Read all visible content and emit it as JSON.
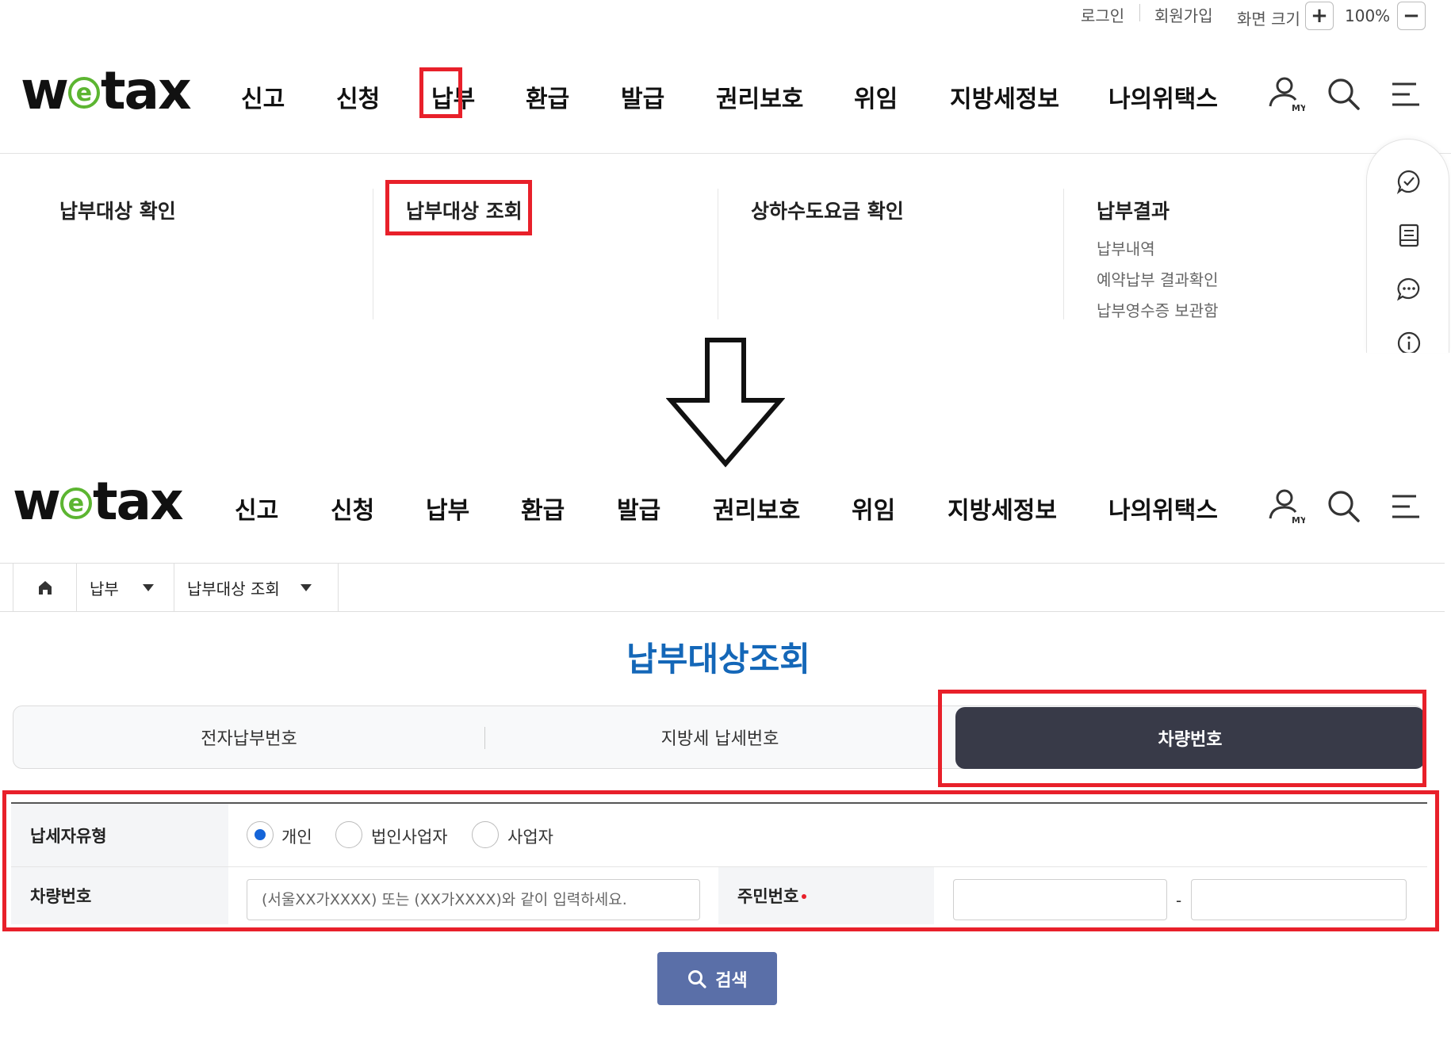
{
  "util_bar": {
    "login": "로그인",
    "signup": "회원가입",
    "screen_size_label": "화면 크기",
    "zoom_in": "+",
    "zoom_level": "100%",
    "zoom_out": "−"
  },
  "logo": {
    "w": "w",
    "e": "e",
    "tax": "tax",
    "accent": "#5cb531"
  },
  "gnb": {
    "items": [
      "신고",
      "신청",
      "납부",
      "환급",
      "발급",
      "권리보호",
      "위임",
      "지방세정보",
      "나의위택스"
    ],
    "icons": [
      "my-page-icon",
      "search-icon",
      "hamburger-menu-icon"
    ],
    "my_icon_text": "MY"
  },
  "mega_menu": {
    "columns": [
      {
        "title": "납부대상 확인",
        "subs": []
      },
      {
        "title": "납부대상 조회",
        "subs": []
      },
      {
        "title": "상하수도요금 확인",
        "subs": []
      },
      {
        "title": "납부결과",
        "subs": [
          "납부내역",
          "예약납부 결과확인",
          "납부영수증 보관함"
        ]
      }
    ],
    "quick_icons": [
      "chat-check-icon",
      "document-icon",
      "chat-bubble-icon",
      "info-icon"
    ]
  },
  "breadcrumb": {
    "home_icon": "home-icon",
    "level1": "납부",
    "level2": "납부대상 조회"
  },
  "page_title": "납부대상조회",
  "tabs": {
    "items": [
      "전자납부번호",
      "지방세 납세번호",
      "차량번호"
    ],
    "active_index": 2,
    "active_color": "#383a48"
  },
  "form": {
    "taxpayer_type_label": "납세자유형",
    "taxpayer_types": [
      "개인",
      "법인사업자",
      "사업자"
    ],
    "selected_type_index": 0,
    "vehicle_label": "차량번호",
    "vehicle_placeholder": "(서울XX가XXXX) 또는 (XX가XXXX)와 같이 입력하세요.",
    "resident_label": "주민번호",
    "resident_separator": "-",
    "resident_front": "",
    "resident_back": ""
  },
  "search_button": {
    "label": "검색",
    "icon": "search-icon",
    "color": "#5a6fa8"
  },
  "highlight_color": "#e8202a"
}
